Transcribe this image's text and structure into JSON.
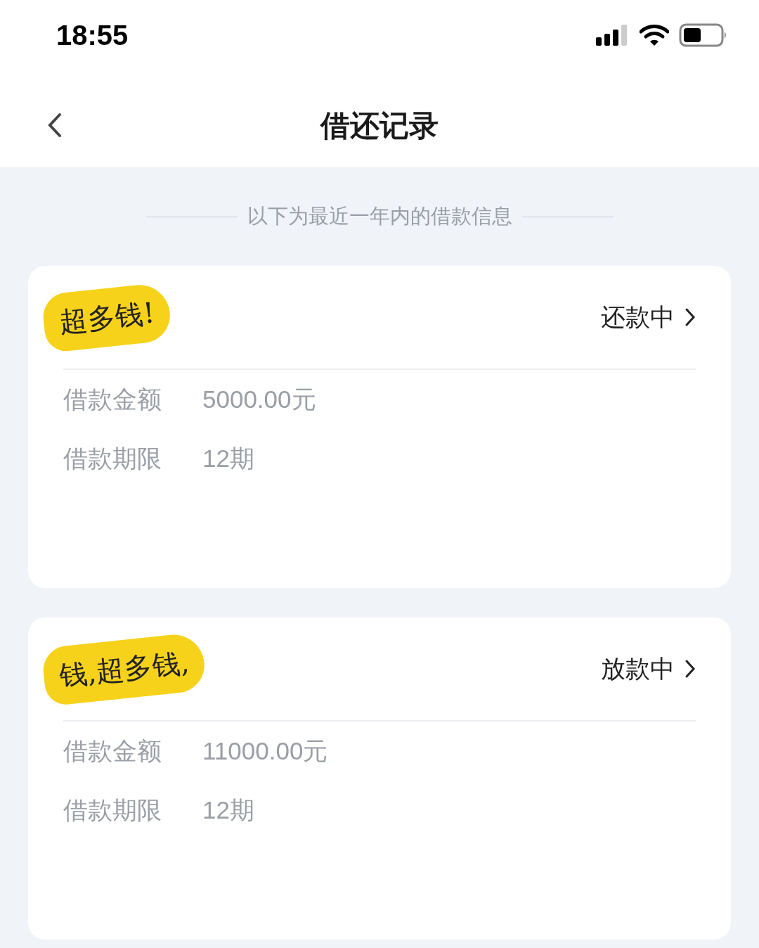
{
  "status_bar": {
    "time": "18:55"
  },
  "nav": {
    "title": "借还记录"
  },
  "notice": "以下为最近一年内的借款信息",
  "loans": [
    {
      "sticker": "超多钱!",
      "status": "还款中",
      "fields": [
        {
          "label": "借款金额",
          "value": "5000.00元"
        },
        {
          "label": "借款期限",
          "value": "12期"
        }
      ]
    },
    {
      "sticker": "钱,超多钱,",
      "status": "放款中",
      "fields": [
        {
          "label": "借款金额",
          "value": "11000.00元"
        },
        {
          "label": "借款期限",
          "value": "12期"
        }
      ]
    }
  ]
}
